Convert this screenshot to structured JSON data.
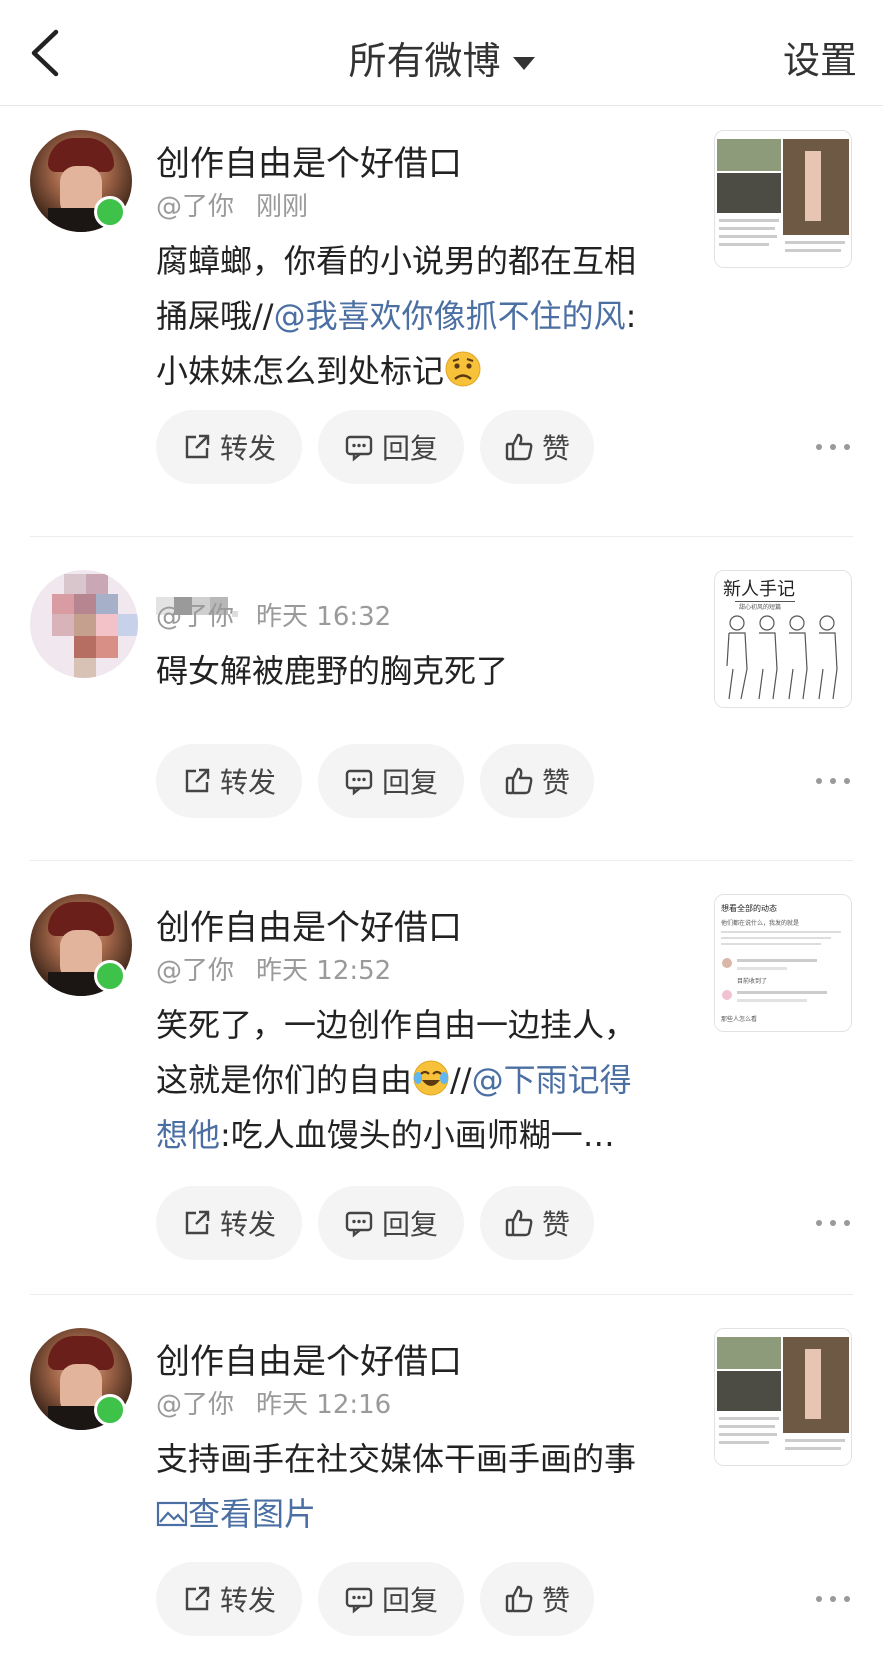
{
  "header": {
    "title": "所有微博",
    "settings": "设置"
  },
  "posts": [
    {
      "name": "创作自由是个好借口",
      "handle": "@了你",
      "time": "刚刚",
      "text_lines": [
        [
          "腐蟑螂，你看的小说男的都在互相"
        ],
        [
          "捅屎哦//",
          "@我喜欢你像抓不住的风",
          ":"
        ],
        [
          "小妹妹怎么到处标记"
        ]
      ],
      "emoji": "worried-face-emoji"
    },
    {
      "name": "",
      "handle": "@了你",
      "time": "昨天 16:32",
      "text_lines": [
        [
          "碍女解被鹿野的胸克死了"
        ]
      ]
    },
    {
      "name": "创作自由是个好借口",
      "handle": "@了你",
      "time": "昨天 12:52",
      "text_lines": [
        [
          "笑死了，一边创作自由一边挂人，"
        ],
        [
          "这就是你们的自由",
          "//",
          "@下雨记得"
        ],
        [
          "想他",
          ":吃人血馒头的小画师糊一…"
        ]
      ],
      "emoji": "tears-of-joy-emoji"
    },
    {
      "name": "创作自由是个好借口",
      "handle": "@了你",
      "time": "昨天 12:16",
      "text_lines": [
        [
          "支持画手在社交媒体干画手画的事"
        ]
      ],
      "view_image": "查看图片"
    }
  ],
  "actions": {
    "repost": "转发",
    "reply": "回复",
    "like": "赞"
  },
  "thumb2_texts": [
    "新人手记",
    "甜心初风的短篇"
  ],
  "thumb3_texts": [
    "想看全部的动态",
    "他们都在说什么，我发的就是",
    "目前收到了",
    "那些人怎么看"
  ],
  "colors": {
    "link": "#4b6fa3",
    "online": "#3fc24a",
    "pill": "#f4f4f4"
  }
}
